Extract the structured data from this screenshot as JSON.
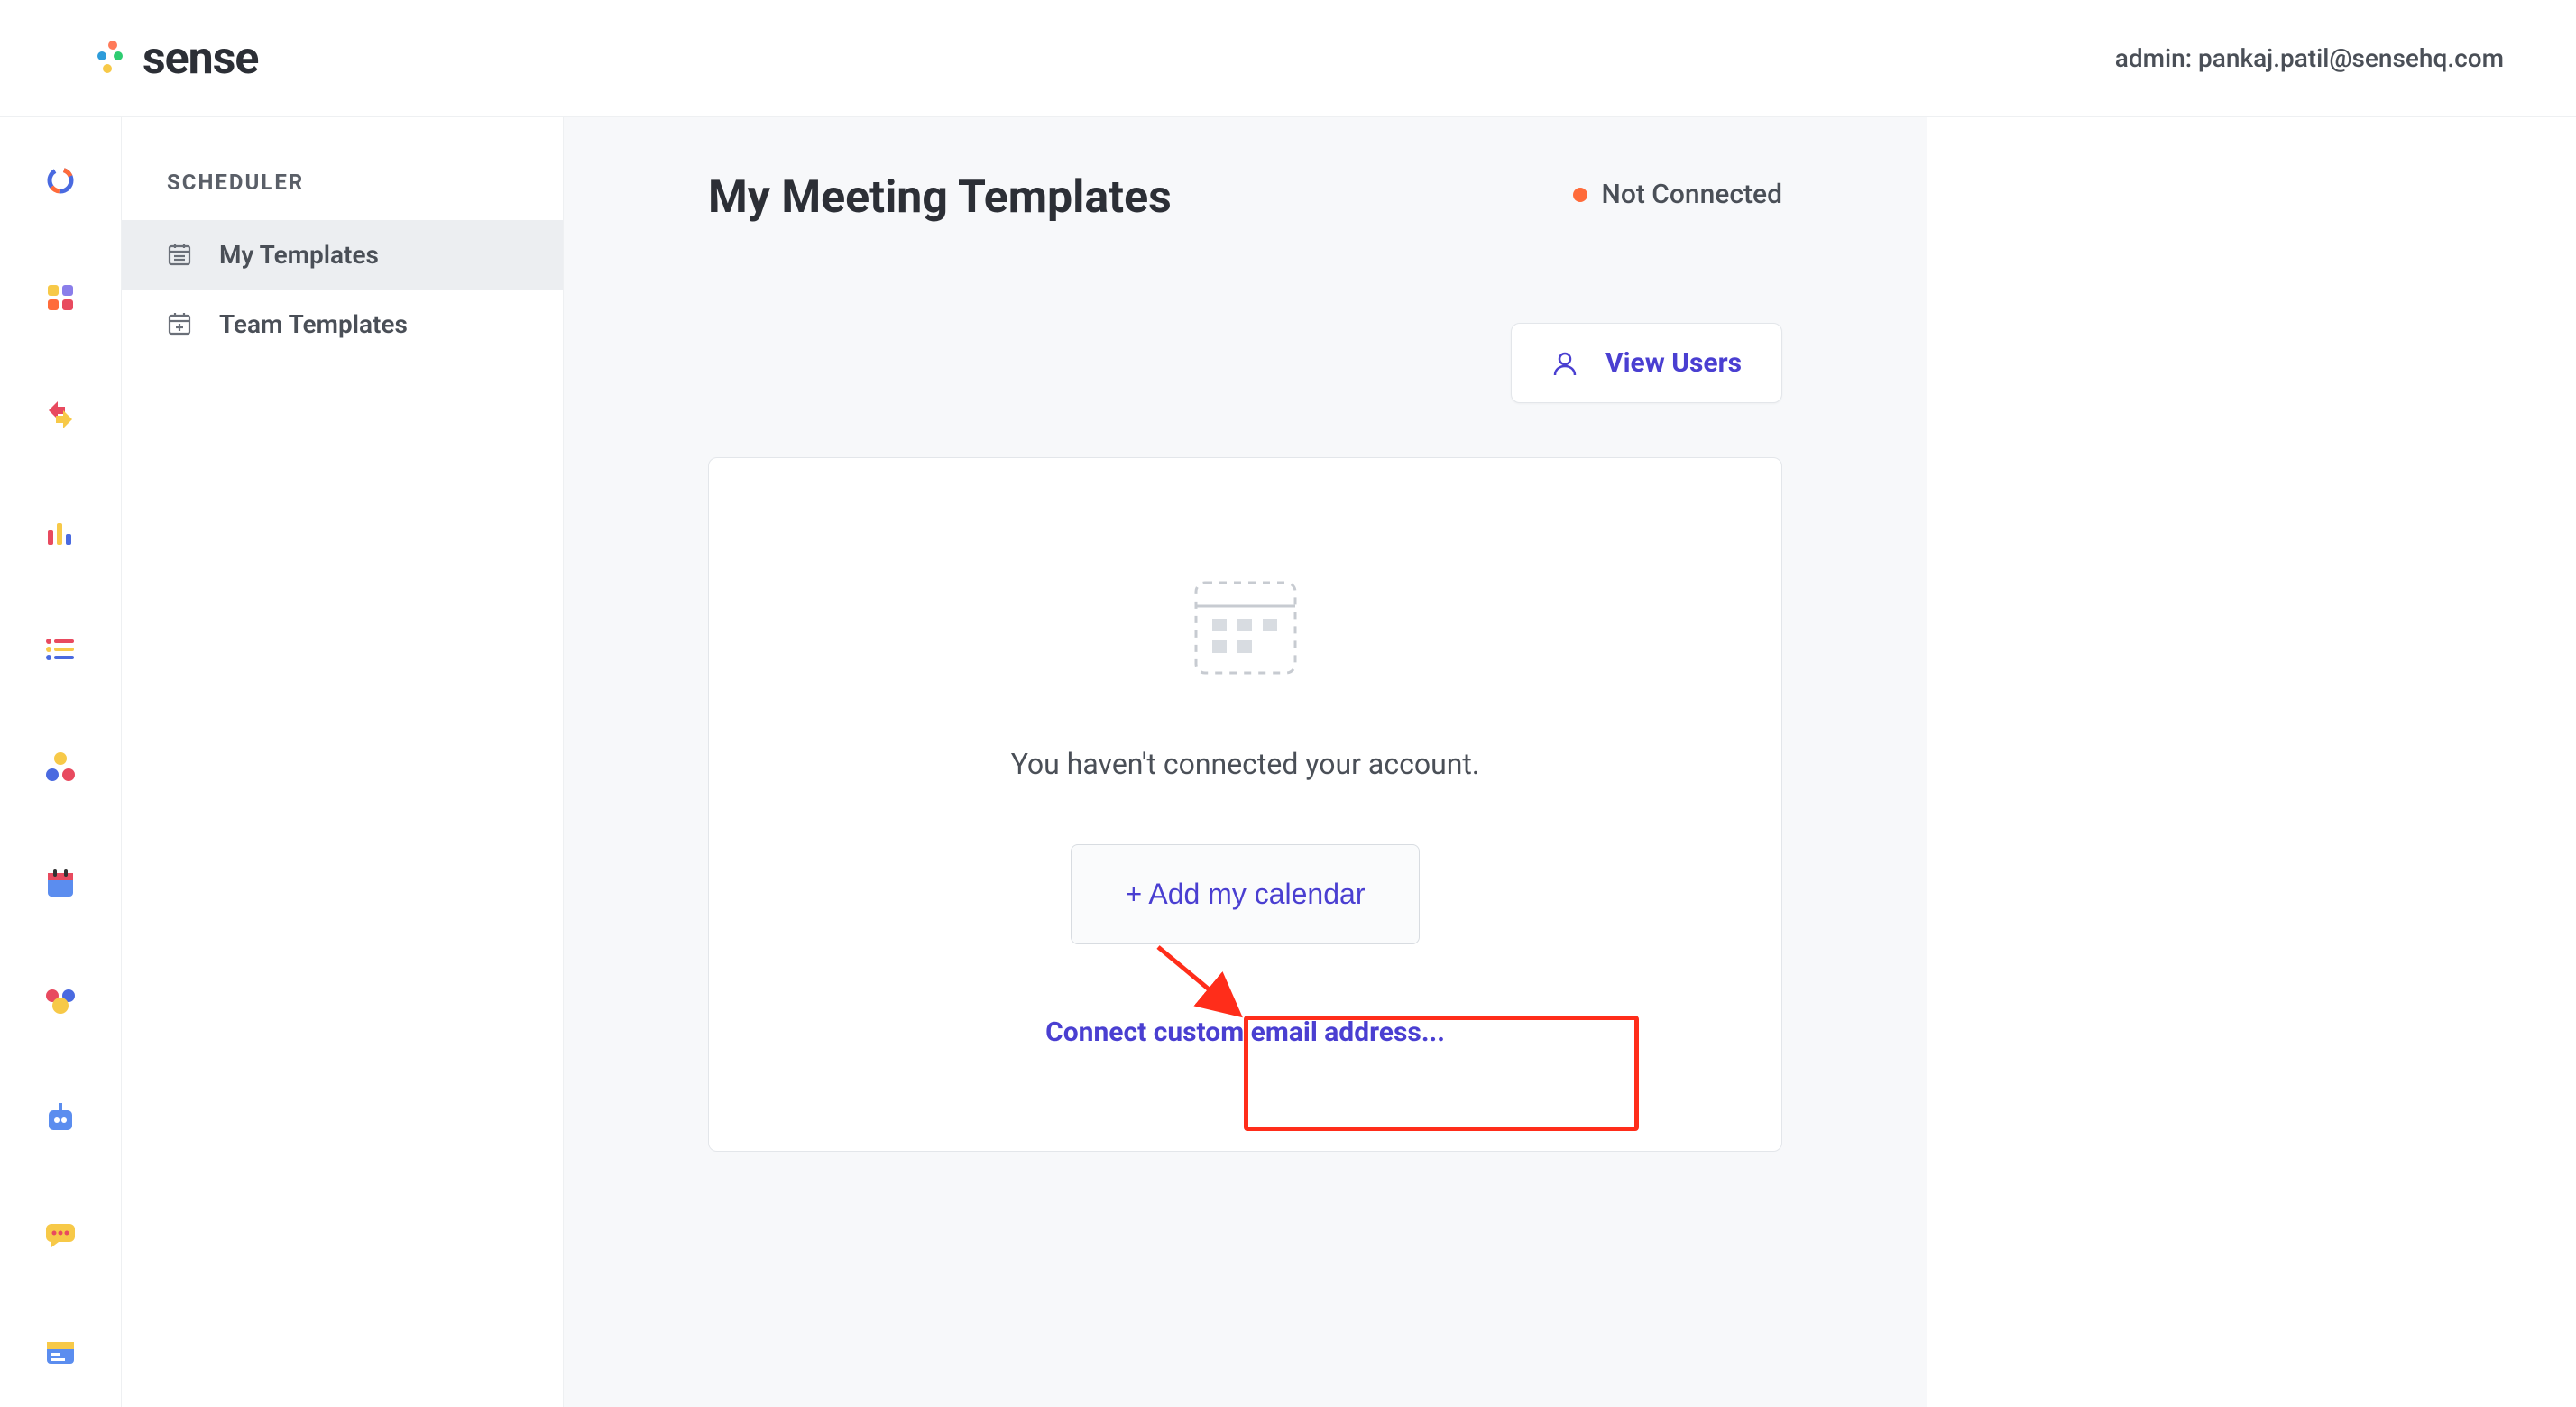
{
  "header": {
    "brand": "sense",
    "user_label": "admin: pankaj.patil@sensehq.com"
  },
  "sidebar": {
    "title": "SCHEDULER",
    "items": [
      {
        "label": "My Templates",
        "active": true
      },
      {
        "label": "Team Templates",
        "active": false
      }
    ]
  },
  "page": {
    "title": "My Meeting Templates",
    "status_label": "Not Connected",
    "view_users_label": "View Users",
    "empty_message": "You haven't connected your account.",
    "add_calendar_label": "+ Add my calendar",
    "connect_email_label": "Connect custom email address..."
  },
  "rail_icons": [
    "ring-icon",
    "dashboard-icon",
    "arrows-icon",
    "bars-icon",
    "list-icon",
    "people-icon",
    "calendar-icon",
    "team-icon",
    "bot-icon",
    "chat-icon",
    "templates-icon"
  ]
}
